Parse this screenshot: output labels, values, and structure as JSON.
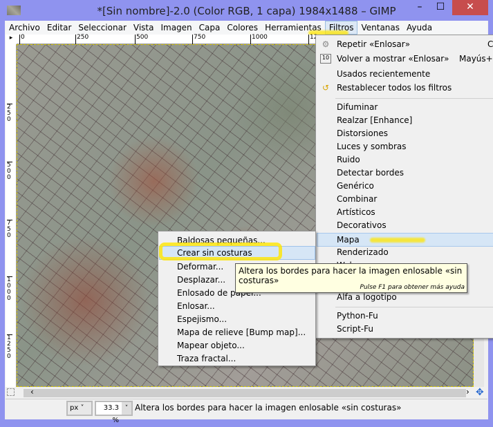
{
  "window": {
    "title": "*[Sin nombre]-2.0 (Color RGB, 1 capa) 1984x1488 – GIMP",
    "minimize": "–",
    "maximize": "☐",
    "close": "✕"
  },
  "menubar": [
    "Archivo",
    "Editar",
    "Seleccionar",
    "Vista",
    "Imagen",
    "Capa",
    "Colores",
    "Herramientas",
    "Filtros",
    "Ventanas",
    "Ayuda"
  ],
  "ruler": {
    "h": [
      "0",
      "250",
      "500",
      "750",
      "1000",
      "12"
    ],
    "v": [
      "250",
      "500",
      "750",
      "1000",
      "1250"
    ]
  },
  "filters_menu": {
    "repeat": "Repetir «Enlosar»",
    "repeat_shortcut": "C",
    "reshow": "Volver a mostrar «Enlosar»",
    "reshow_shortcut": "Mayús+C",
    "recent": "Usados recientemente",
    "reset": "Restablecer todos los filtros",
    "items": [
      "Difuminar",
      "Realzar [Enhance]",
      "Distorsiones",
      "Luces y sombras",
      "Ruido",
      "Detectar bordes",
      "Genérico",
      "Combinar",
      "Artísticos",
      "Decorativos",
      "Mapa",
      "Renderizado",
      "Web"
    ],
    "alpha": "Alfa a logotipo",
    "python": "Python-Fu",
    "script": "Script-Fu"
  },
  "map_submenu": [
    "Baldosas pequeñas...",
    "Crear sin costuras",
    "Deformar...",
    "Desplazar...",
    "Enlosado de papel...",
    "Enlosar...",
    "Espejismo...",
    "Mapa de relieve [Bump map]...",
    "Mapear objeto...",
    "Traza fractal..."
  ],
  "tooltip": {
    "text": "Altera los bordes para hacer la imagen enlosable «sin costuras»",
    "help": "Pulse F1 para obtener más ayuda"
  },
  "status": {
    "unit": "px",
    "zoom": "33.3 %",
    "message": "Altera los bordes para hacer la imagen enlosable «sin costuras»"
  }
}
